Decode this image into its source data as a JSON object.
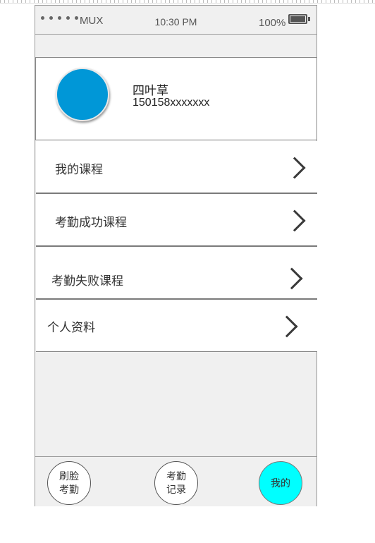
{
  "status_bar": {
    "carrier": "MUX",
    "time": "10:30 PM",
    "battery": "100%"
  },
  "profile": {
    "name": "四叶草",
    "phone": "150158xxxxxxx",
    "avatar_color": "#0097d7"
  },
  "menu": {
    "items": [
      {
        "label": "我的课程",
        "icon": "chevron-right-icon"
      },
      {
        "label": "考勤成功课程",
        "icon": "chevron-right-icon"
      },
      {
        "label": "考勤失败课程",
        "icon": "chevron-right-icon"
      },
      {
        "label": "个人资料",
        "icon": "chevron-right-icon"
      }
    ]
  },
  "tab_bar": {
    "tabs": [
      {
        "label": "刷脸考勤",
        "active": false
      },
      {
        "label": "考勤记录",
        "active": false
      },
      {
        "label": "我的",
        "active": true
      }
    ],
    "active_color": "#00ffff"
  }
}
